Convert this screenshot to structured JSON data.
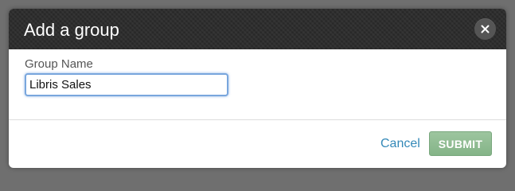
{
  "dialog": {
    "title": "Add a group",
    "close_label": "X",
    "close_icon": "close-icon"
  },
  "form": {
    "group_name_label": "Group Name",
    "group_name_value": "Libris Sales"
  },
  "footer": {
    "cancel_label": "Cancel",
    "submit_label": "SUBMIT"
  },
  "colors": {
    "header_background": "#2e2e2e",
    "link": "#3489b8",
    "submit_background": "#8fbc91",
    "input_focus_border": "#79a6dd"
  }
}
